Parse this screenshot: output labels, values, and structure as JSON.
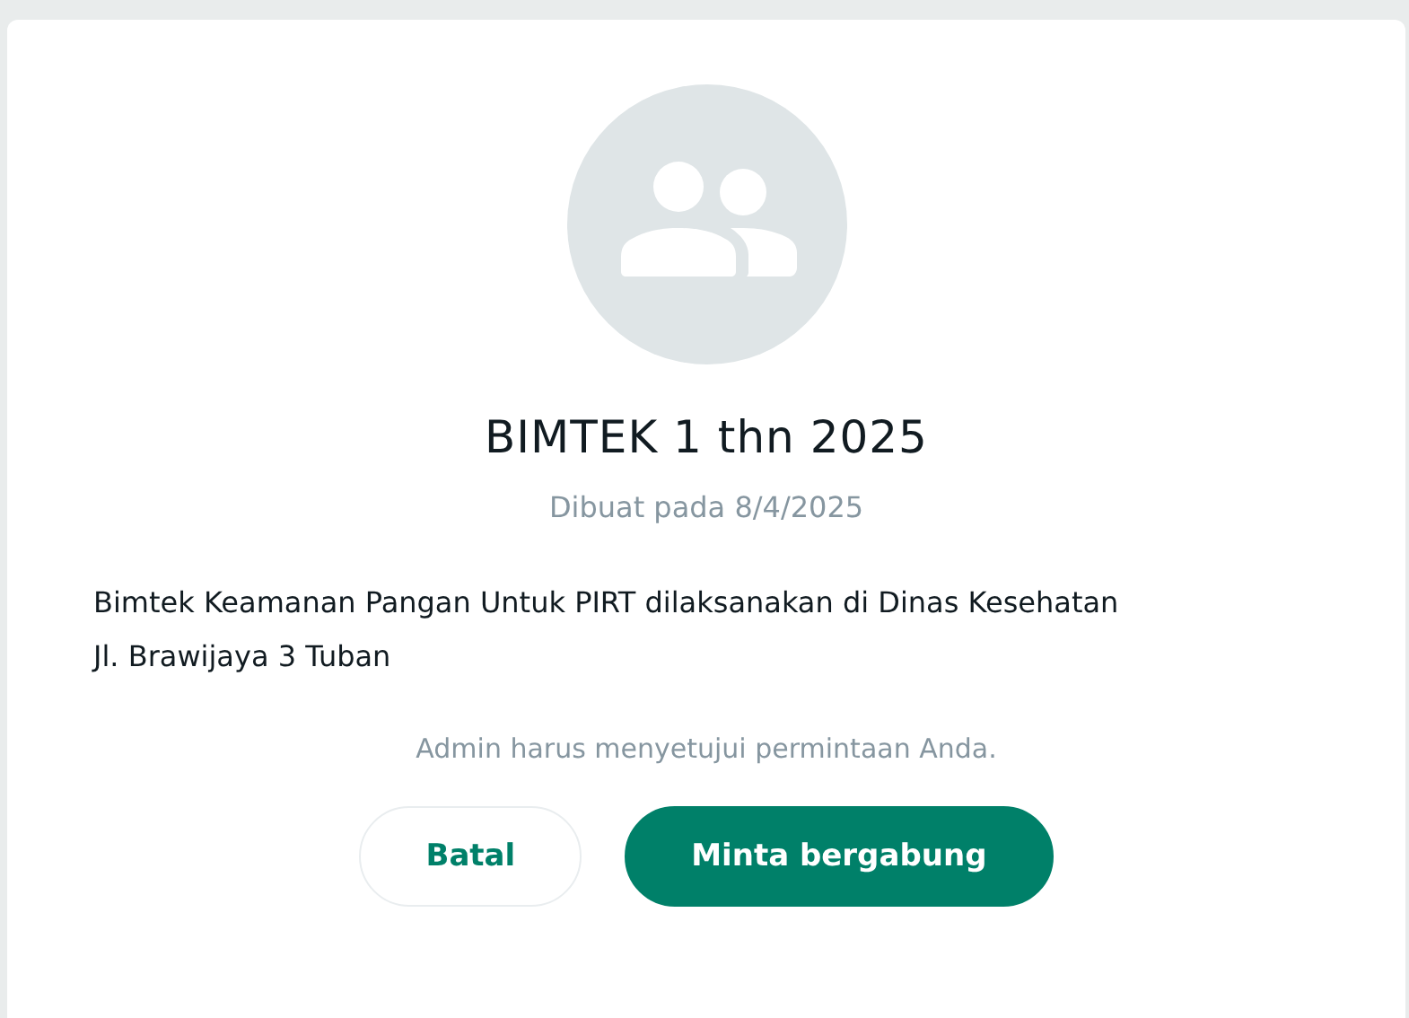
{
  "dialog": {
    "group_name": "BIMTEK 1 thn 2025",
    "created": "Dibuat pada 8/4/2025",
    "description": "Bimtek Keamanan Pangan Untuk PIRT dilaksanakan di Dinas Kesehatan\nJl. Brawijaya 3 Tuban",
    "note": "Admin harus menyetujui permintaan Anda.",
    "buttons": [
      {
        "label": "Batal",
        "kind": "secondary"
      },
      {
        "label": "Minta bergabung",
        "kind": "primary"
      }
    ]
  }
}
